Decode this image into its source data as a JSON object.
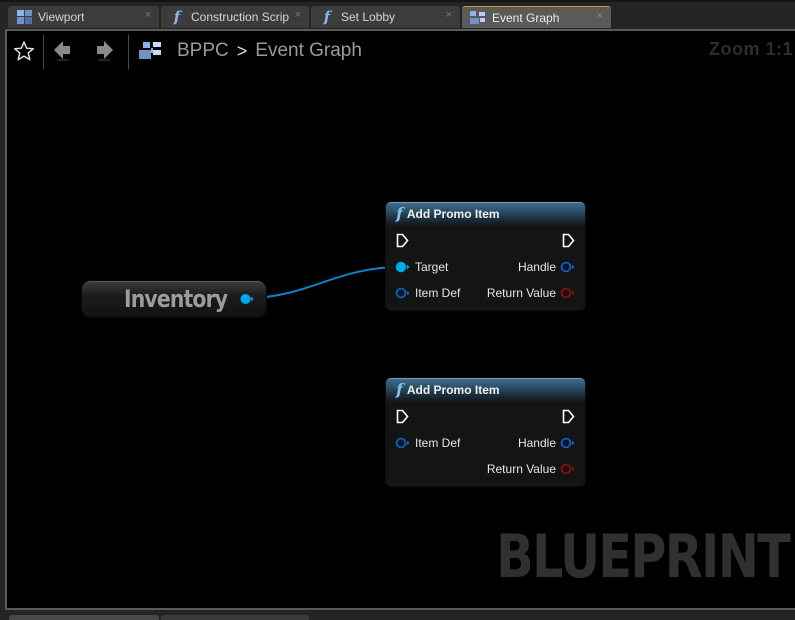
{
  "tabs": [
    {
      "label": "Viewport",
      "icon": "viewport-icon",
      "active": false
    },
    {
      "label": "Construction Scrip",
      "icon": "function-icon",
      "active": false
    },
    {
      "label": "Set Lobby",
      "icon": "function-icon",
      "active": false
    },
    {
      "label": "Event Graph",
      "icon": "event-graph-icon",
      "active": true
    }
  ],
  "tab_close_glyph": "×",
  "function_glyph": "f",
  "toolbar": {
    "favorite_icon": "star-icon",
    "back_icon": "back-arrow-icon",
    "forward_icon": "forward-arrow-icon"
  },
  "breadcrumb": {
    "icon": "event-graph-icon",
    "items": [
      "BPPC",
      "Event Graph"
    ],
    "separator": ">"
  },
  "zoom_label": "Zoom 1:1",
  "nodes": [
    {
      "title": "Add Promo Item",
      "type": "function",
      "inputs": [
        {
          "label": "Target",
          "type": "object",
          "connected": true
        },
        {
          "label": "Item Def",
          "type": "object",
          "connected": false
        }
      ],
      "outputs": [
        {
          "label": "Handle",
          "type": "struct",
          "connected": false
        },
        {
          "label": "Return Value",
          "type": "bool",
          "connected": false
        }
      ]
    },
    {
      "title": "Add Promo Item",
      "type": "function",
      "inputs": [
        {
          "label": "Item Def",
          "type": "object",
          "connected": false
        }
      ],
      "outputs": [
        {
          "label": "Handle",
          "type": "struct",
          "connected": false
        },
        {
          "label": "Return Value",
          "type": "bool",
          "connected": false
        }
      ]
    }
  ],
  "variable_node": {
    "label": "Inventory"
  },
  "watermark": "BLUEPRINT",
  "colors": {
    "object_pin": "#00a8f0",
    "struct_pin": "#0a5fc8",
    "bool_pin": "#8c0a0a",
    "exec_pin": "#ffffff",
    "active_tab_accent": "#c8a030",
    "node_header": "#3f6d8f"
  }
}
